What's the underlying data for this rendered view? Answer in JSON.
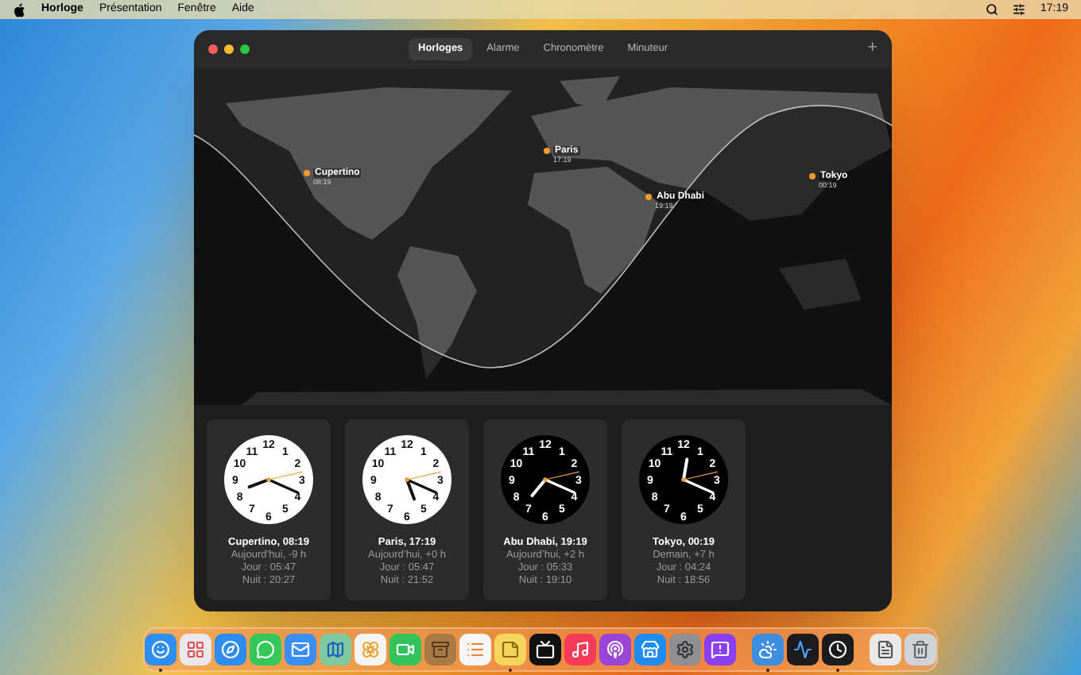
{
  "menu_bar": {
    "app_name": "Horloge",
    "menus": [
      "Présentation",
      "Fenêtre",
      "Aide"
    ],
    "time": "17:19"
  },
  "window": {
    "tabs": [
      {
        "label": "Horloges",
        "selected": true
      },
      {
        "label": "Alarme",
        "selected": false
      },
      {
        "label": "Chronomètre",
        "selected": false
      },
      {
        "label": "Minuteur",
        "selected": false
      }
    ],
    "add_button": "+",
    "map": {
      "pins": [
        {
          "city": "Cupertino",
          "time": "08:19"
        },
        {
          "city": "Paris",
          "time": "17:19"
        },
        {
          "city": "Abu Dhabi",
          "time": "19:19"
        },
        {
          "city": "Tokyo",
          "time": "00:19"
        }
      ]
    },
    "clocks": [
      {
        "title": "Cupertino, 08:19",
        "offset": "Aujourd’hui, -9 h",
        "day": "Jour : 05:47",
        "night": "Nuit : 20:27",
        "dark_face": false,
        "numerals": [
          "12",
          "11",
          "1",
          "10",
          "2",
          "9",
          "3",
          "8",
          "4",
          "7",
          "5",
          "6"
        ]
      },
      {
        "title": "Paris, 17:19",
        "offset": "Aujourd’hui, +0 h",
        "day": "Jour : 05:47",
        "night": "Nuit : 21:52",
        "dark_face": false,
        "numerals": [
          "12",
          "11",
          "1",
          "10",
          "2",
          "9",
          "3",
          "8",
          "4",
          "7",
          "5",
          "6"
        ]
      },
      {
        "title": "Abu Dhabi, 19:19",
        "offset": "Aujourd’hui, +2 h",
        "day": "Jour : 05:33",
        "night": "Nuit : 19:10",
        "dark_face": true,
        "numerals": [
          "12",
          "11",
          "1",
          "10",
          "2",
          "9",
          "3",
          "8",
          "4",
          "7",
          "5",
          "6"
        ]
      },
      {
        "title": "Tokyo, 00:19",
        "offset": "Demain, +7 h",
        "day": "Jour : 04:24",
        "night": "Nuit : 18:56",
        "dark_face": true,
        "numerals": [
          "12",
          "11",
          "1",
          "10",
          "2",
          "9",
          "3",
          "8",
          "4",
          "7",
          "5",
          "6"
        ]
      }
    ]
  },
  "dock": {
    "groups": [
      {
        "items": [
          {
            "kind": "finder",
            "color": "#2f8ff0",
            "running": true
          },
          {
            "kind": "launchpad",
            "color": "#e8e8ee",
            "running": false
          },
          {
            "kind": "safari",
            "color": "#2d8cf0",
            "running": false
          },
          {
            "kind": "messages",
            "color": "#34c759",
            "running": false
          },
          {
            "kind": "mail",
            "color": "#3a8ef6",
            "running": false
          },
          {
            "kind": "maps",
            "color": "#7fc9a0",
            "running": false
          },
          {
            "kind": "photos",
            "color": "#f4f4f4",
            "running": false
          },
          {
            "kind": "facetime",
            "color": "#32c45a",
            "running": false
          },
          {
            "kind": "archive",
            "color": "#a87a45",
            "running": false
          },
          {
            "kind": "reminders",
            "color": "#f6f6f6",
            "running": false
          },
          {
            "kind": "notes",
            "color": "#f7d55c",
            "running": true
          },
          {
            "kind": "tv",
            "color": "#111111",
            "running": false
          },
          {
            "kind": "music",
            "color": "#f53b57",
            "running": false
          },
          {
            "kind": "podcasts",
            "color": "#9a45d8",
            "running": false
          },
          {
            "kind": "appstore",
            "color": "#1e8ef5",
            "running": false
          },
          {
            "kind": "settings",
            "color": "#8e8e93",
            "running": false
          },
          {
            "kind": "feedback",
            "color": "#8a3ff0",
            "running": false
          }
        ]
      },
      {
        "items": [
          {
            "kind": "weather",
            "color": "#3d8de0",
            "running": true
          },
          {
            "kind": "stocks",
            "color": "#1c1c1e",
            "running": false
          },
          {
            "kind": "clock",
            "color": "#1c1c1e",
            "running": true
          }
        ]
      },
      {
        "items": [
          {
            "kind": "file",
            "color": "#e9e9ea",
            "running": false
          },
          {
            "kind": "trash",
            "color": "#cfd3d6",
            "running": false
          }
        ]
      }
    ]
  }
}
